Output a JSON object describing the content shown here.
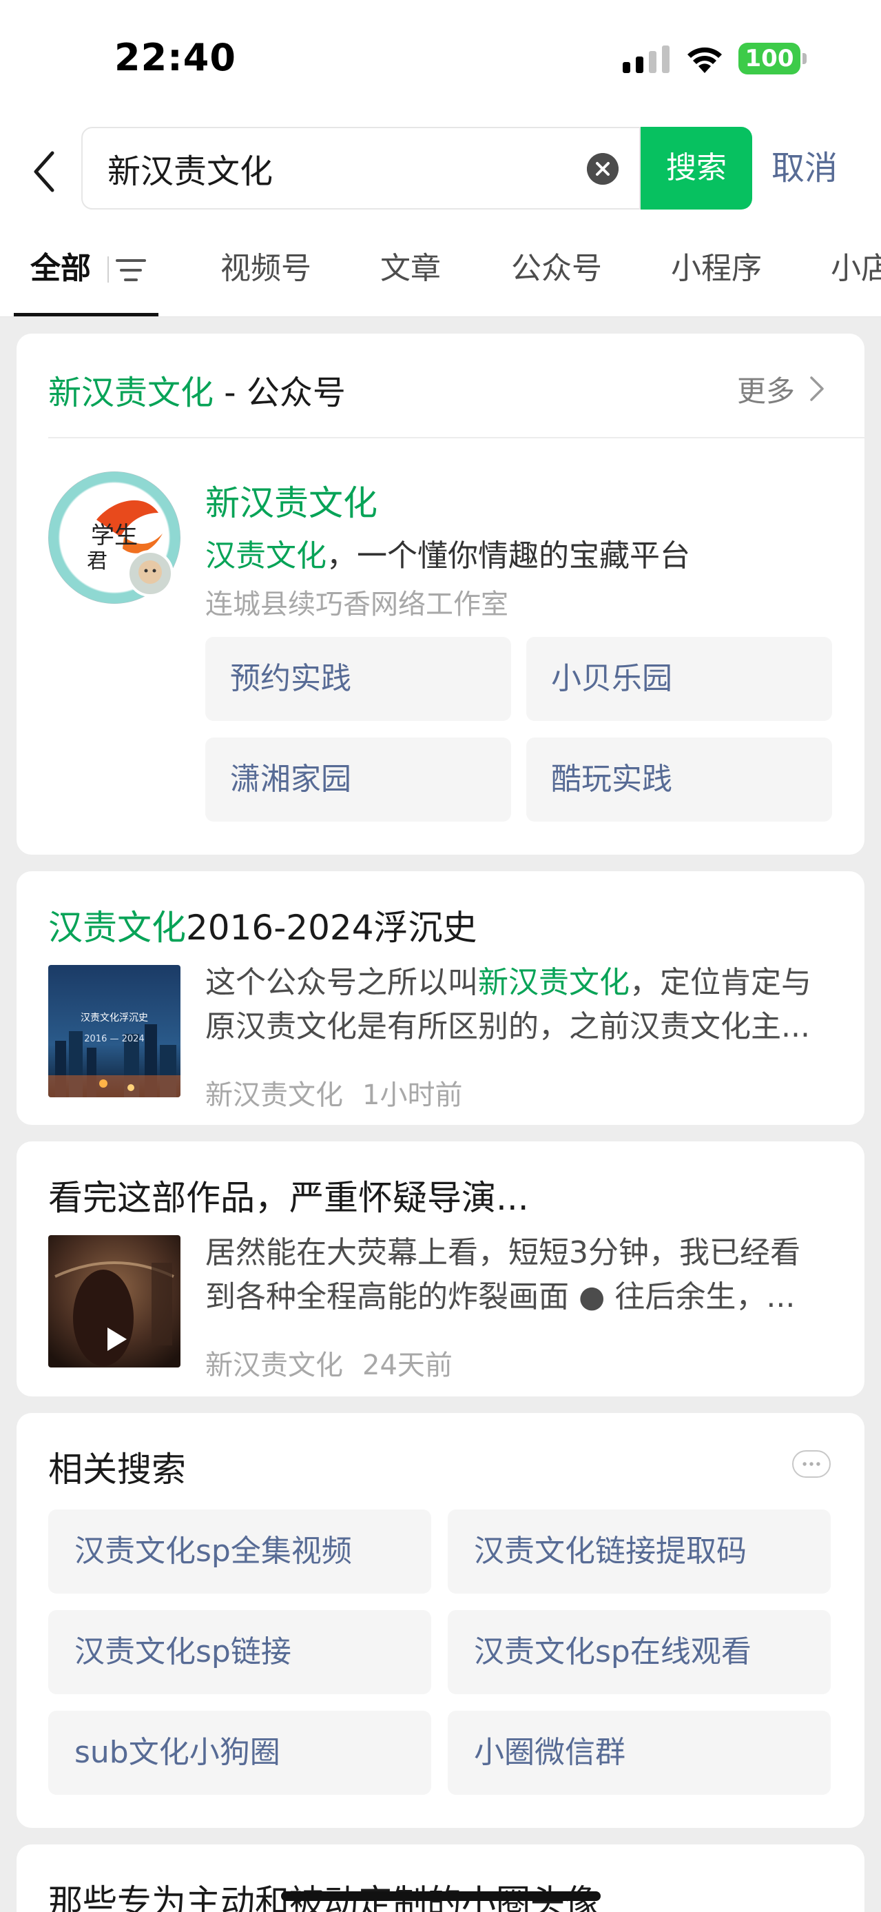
{
  "status_bar": {
    "time": "22:40",
    "battery": "100"
  },
  "search": {
    "query": "新汉责文化",
    "search_label": "搜索",
    "cancel_label": "取消"
  },
  "tabs": [
    "全部",
    "视频号",
    "文章",
    "公众号",
    "小程序",
    "小店"
  ],
  "account_card": {
    "title_highlight": "新汉责文化",
    "title_suffix": " - 公众号",
    "more_label": "更多",
    "name": "新汉责文化",
    "desc_highlight": "汉责文化",
    "desc_rest": "，一个懂你情趣的宝藏平台",
    "org": "连城县续巧香网络工作室",
    "menu": [
      "预约实践",
      "小贝乐园",
      "潇湘家园",
      "酷玩实践"
    ]
  },
  "articles": [
    {
      "title_highlight": "汉责文化",
      "title_rest": "2016-2024浮沉史",
      "desc_line1_pre": "这个公众号之所以叫",
      "desc_line1_hl": "新汉责文化",
      "desc_line1_post": "，定位肯定与",
      "desc_line2": "原汉责文化是有所区别的，之前汉责文化主...",
      "source": "新汉责文化",
      "time": "1小时前",
      "thumb_line1": "汉责文化浮沉史",
      "thumb_line2": "2016 — 2024"
    },
    {
      "title": "看完这部作品，严重怀疑导演...",
      "desc_line1": "居然能在大荧幕上看，短短3分钟，我已经看",
      "desc_line2": "到各种全程高能的炸裂画面 ● 往后余生，...",
      "source": "新汉责文化",
      "time": "24天前"
    }
  ],
  "related": {
    "title": "相关搜索",
    "items": [
      "汉责文化sp全集视频",
      "汉责文化链接提取码",
      "汉责文化sp链接",
      "汉责文化sp在线观看",
      "sub文化小狗圈",
      "小圈微信群"
    ]
  },
  "bottom_card": {
    "title": "那些专为主动和被动定制的小圈头像"
  },
  "colors": {
    "accent_green": "#07c160",
    "highlight_green": "#07a357",
    "link_blue": "#576b95"
  }
}
